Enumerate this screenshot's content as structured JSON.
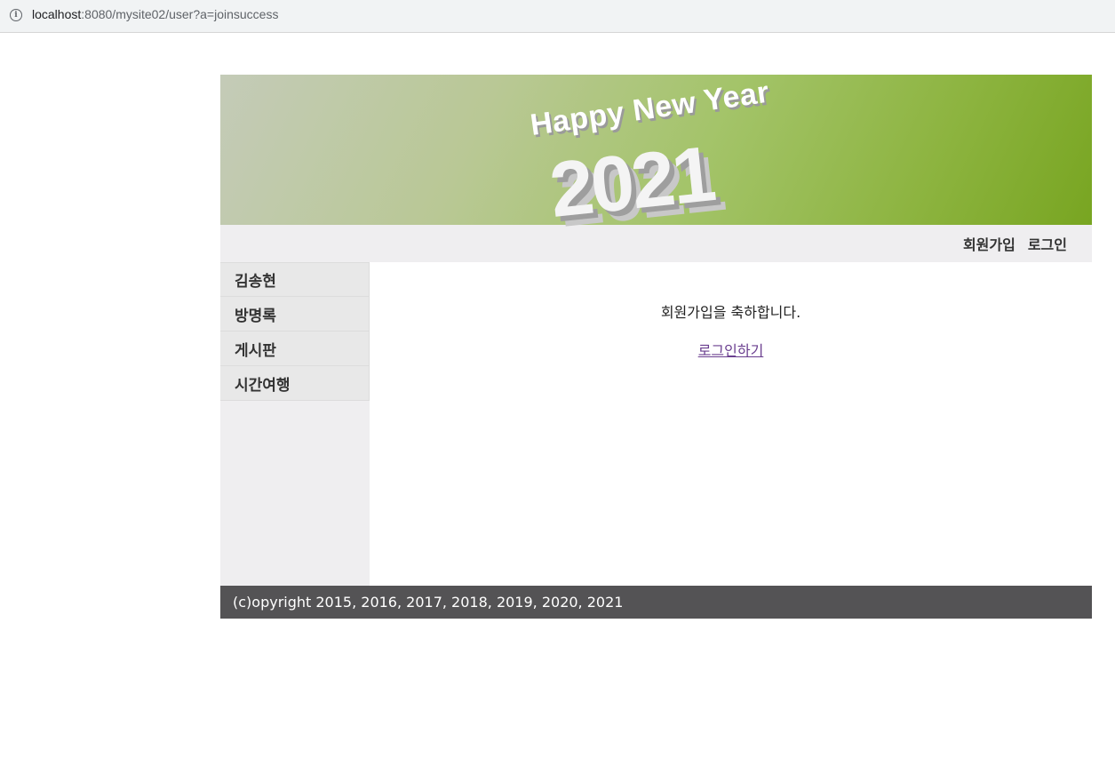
{
  "browser": {
    "url_host": "localhost",
    "url_rest": ":8080/mysite02/user?a=joinsuccess",
    "info_icon": "info-icon"
  },
  "banner": {
    "greeting": "Happy New Year",
    "year": "2021"
  },
  "topnav": {
    "join_label": "회원가입",
    "login_label": "로그인"
  },
  "sidebar": {
    "items": [
      {
        "label": "김송현"
      },
      {
        "label": "방명록"
      },
      {
        "label": "게시판"
      },
      {
        "label": "시간여행"
      }
    ]
  },
  "content": {
    "message": "회원가입을 축하합니다.",
    "login_link": "로그인하기"
  },
  "footer": {
    "copyright": "(c)opyright 2015, 2016, 2017, 2018, 2019, 2020, 2021"
  },
  "colors": {
    "banner_start": "#c4cbb8",
    "banner_end": "#78a521",
    "nav_bg": "#efeef0",
    "footer_bg": "#545355",
    "link": "#6a3e8f"
  }
}
